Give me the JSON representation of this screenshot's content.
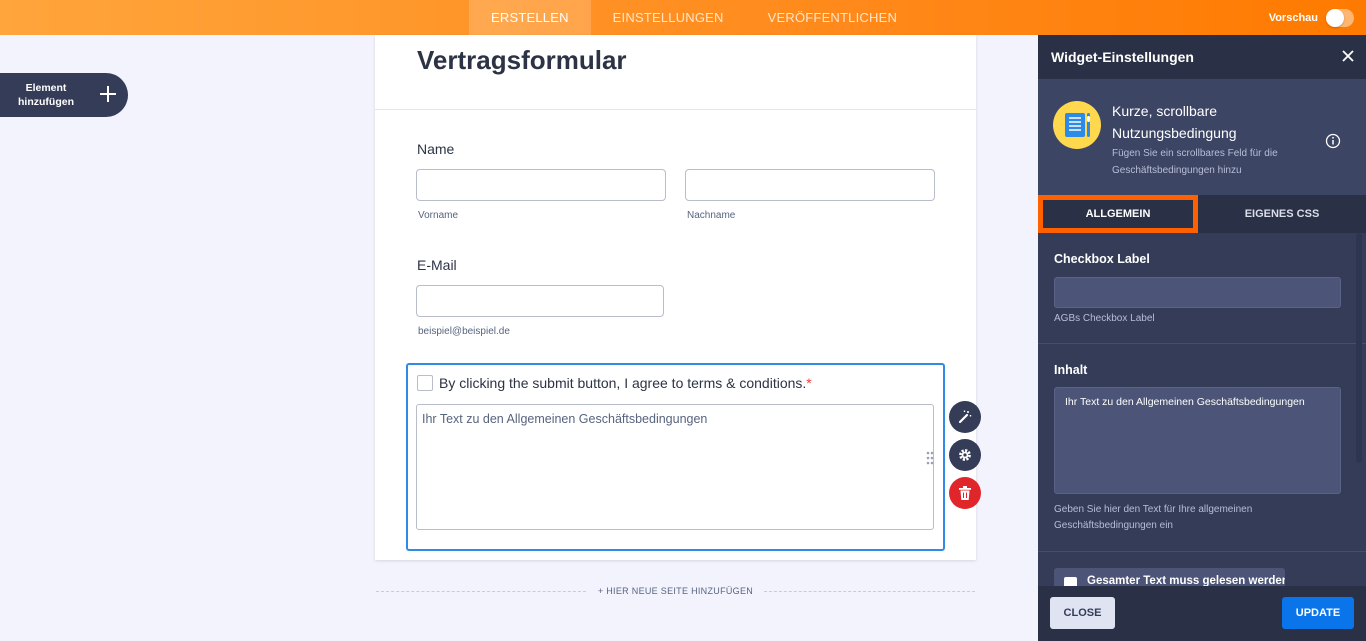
{
  "topbar": {
    "tabs": [
      {
        "label": "ERSTELLEN",
        "active": true
      },
      {
        "label": "EINSTELLUNGEN",
        "active": false
      },
      {
        "label": "VERÖFFENTLICHEN",
        "active": false
      }
    ],
    "preview_label": "Vorschau",
    "preview_on": false
  },
  "sidebar": {
    "add_element_label": "Element hinzufügen"
  },
  "form": {
    "title": "Vertragsformular",
    "name_label": "Name",
    "first_name_sub": "Vorname",
    "last_name_sub": "Nachname",
    "email_label": "E-Mail",
    "email_sub": "beispiel@beispiel.de",
    "terms_checkbox_label": "By clicking the submit button, I agree to terms & conditions.",
    "required_mark": "*",
    "terms_text": "Ihr Text zu den Allgemeinen Geschäftsbedingungen",
    "add_page_label": "+ HIER NEUE SEITE HINZUFÜGEN"
  },
  "panel": {
    "title": "Widget-Einstellungen",
    "widget_name": "Kurze, scrollbare Nutzungsbedingung",
    "widget_desc": "Fügen Sie ein scrollbares Feld für die Geschäftsbedingungen hinzu",
    "tabs": [
      {
        "label": "ALLGEMEIN",
        "active": true
      },
      {
        "label": "EIGENES CSS",
        "active": false
      }
    ],
    "checkbox_label_title": "Checkbox Label",
    "checkbox_label_value": "",
    "checkbox_label_help": "AGBs Checkbox Label",
    "content_title": "Inhalt",
    "content_value": "Ihr Text zu den Allgemeinen Geschäftsbedingungen",
    "content_help": "Geben Sie hier den Text für Ihre allgemeinen Geschäftsbedingungen ein",
    "must_read_label": "Gesamter Text muss gelesen werden",
    "close_button": "CLOSE",
    "update_button": "UPDATE"
  },
  "colors": {
    "topbar_start": "#ffa53b",
    "topbar_end": "#ff7a00",
    "panel_bg": "#343c58",
    "active_tab_outline": "#ff6100",
    "selection_border": "#2f8be6",
    "delete": "#e0262b",
    "update": "#0a75eb"
  }
}
